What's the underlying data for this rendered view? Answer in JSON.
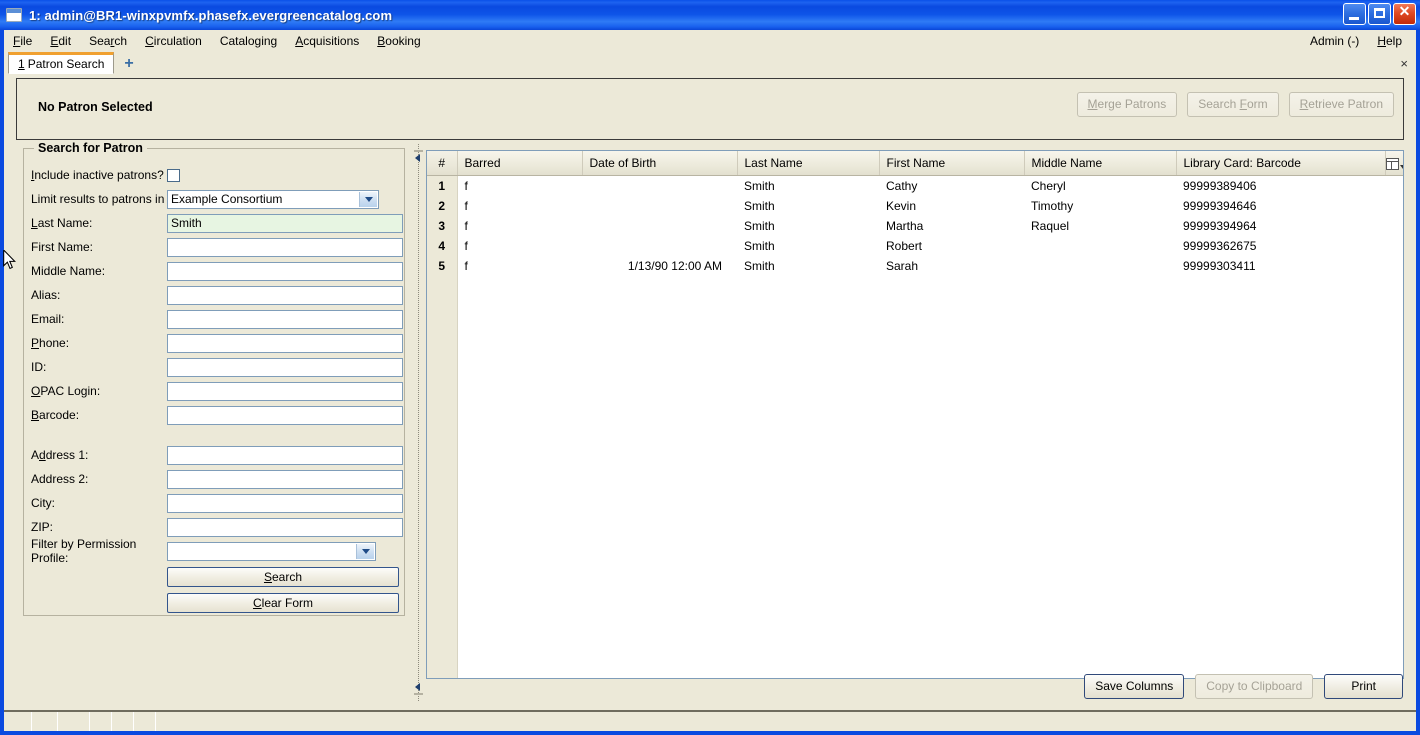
{
  "window": {
    "title": "1: admin@BR1-winxpvmfx.phasefx.evergreencatalog.com",
    "minimize_label": "",
    "maximize_label": "",
    "close_label": ""
  },
  "menubar": {
    "items": [
      {
        "label": "File",
        "accel": "F"
      },
      {
        "label": "Edit",
        "accel": "E"
      },
      {
        "label": "Search",
        "accel": "r"
      },
      {
        "label": "Circulation",
        "accel": "C"
      },
      {
        "label": "Cataloging",
        "accel": "g"
      },
      {
        "label": "Acquisitions",
        "accel": "A"
      },
      {
        "label": "Booking",
        "accel": "B"
      }
    ],
    "right_items": [
      {
        "label": "Admin (-)"
      },
      {
        "label": "Help",
        "accel": "H"
      }
    ]
  },
  "tabbar": {
    "tabs": [
      {
        "number": "1",
        "label": "Patron Search",
        "active": true
      }
    ],
    "new_tab_label": "+",
    "close_label": "×"
  },
  "patron_header": {
    "title": "No Patron Selected",
    "buttons": [
      {
        "label": "Merge Patrons",
        "disabled": true
      },
      {
        "label": "Search Form",
        "disabled": true
      },
      {
        "label": "Retrieve Patron",
        "disabled": true
      }
    ]
  },
  "search_form": {
    "legend": "Search for Patron",
    "fields": [
      {
        "label": "Include inactive patrons?",
        "type": "checkbox",
        "value": "",
        "checked": false
      },
      {
        "label": "Limit results to patrons in",
        "type": "select",
        "value": "Example Consortium"
      },
      {
        "label": "Last Name:",
        "type": "text",
        "value": "Smith",
        "focused": true
      },
      {
        "label": "First Name:",
        "type": "text",
        "value": ""
      },
      {
        "label": "Middle Name:",
        "type": "text",
        "value": ""
      },
      {
        "label": "Alias:",
        "type": "text",
        "value": ""
      },
      {
        "label": "Email:",
        "type": "text",
        "value": ""
      },
      {
        "label": "Phone:",
        "type": "text",
        "value": ""
      },
      {
        "label": "ID:",
        "type": "text",
        "value": ""
      },
      {
        "label": "OPAC Login:",
        "type": "text",
        "value": ""
      },
      {
        "label": "Barcode:",
        "type": "text",
        "value": ""
      },
      {
        "label": "Address 1:",
        "type": "text",
        "value": ""
      },
      {
        "label": "Address 2:",
        "type": "text",
        "value": ""
      },
      {
        "label": "City:",
        "type": "text",
        "value": ""
      },
      {
        "label": "ZIP:",
        "type": "text",
        "value": ""
      },
      {
        "label": "Filter by Permission Profile:",
        "type": "select",
        "value": ""
      }
    ],
    "search_button": "Search",
    "clear_button": "Clear Form"
  },
  "results": {
    "columns": [
      {
        "key": "num",
        "label": "#"
      },
      {
        "key": "barred",
        "label": "Barred"
      },
      {
        "key": "dob",
        "label": "Date of Birth"
      },
      {
        "key": "last",
        "label": "Last Name"
      },
      {
        "key": "first",
        "label": "First Name"
      },
      {
        "key": "middle",
        "label": "Middle Name"
      },
      {
        "key": "barcode",
        "label": "Library Card: Barcode"
      }
    ],
    "rows": [
      {
        "num": "1",
        "barred": "f",
        "dob": "",
        "last": "Smith",
        "first": "Cathy",
        "middle": "Cheryl",
        "barcode": "99999389406"
      },
      {
        "num": "2",
        "barred": "f",
        "dob": "",
        "last": "Smith",
        "first": "Kevin",
        "middle": "Timothy",
        "barcode": "99999394646"
      },
      {
        "num": "3",
        "barred": "f",
        "dob": "",
        "last": "Smith",
        "first": "Martha",
        "middle": "Raquel",
        "barcode": "99999394964"
      },
      {
        "num": "4",
        "barred": "f",
        "dob": "",
        "last": "Smith",
        "first": "Robert",
        "middle": "",
        "barcode": "99999362675"
      },
      {
        "num": "5",
        "barred": "f",
        "dob": "1/13/90 12:00 AM",
        "last": "Smith",
        "first": "Sarah",
        "middle": "",
        "barcode": "99999303411"
      }
    ],
    "column_picker_name": "column-picker",
    "actions": [
      {
        "label": "Save Columns",
        "disabled": false
      },
      {
        "label": "Copy to Clipboard",
        "disabled": true
      },
      {
        "label": "Print",
        "disabled": false
      }
    ]
  },
  "statusbar": {
    "cells": [
      "",
      "",
      "",
      "",
      "",
      "",
      ""
    ]
  },
  "colors": {
    "titlebar_blue": "#0a4ae0",
    "chrome_beige": "#ece9d8",
    "focus_field_green": "#e7f5e2",
    "tab_accent_orange": "#f0a030",
    "field_border_blue": "#7f9db9"
  }
}
